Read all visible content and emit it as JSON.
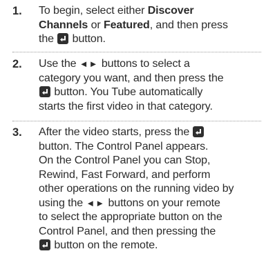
{
  "steps": [
    {
      "number": "1.",
      "s1_a": "To begin, select either ",
      "s1_b": "Discover",
      "s1_c": "Channels",
      "s1_d": " or ",
      "s1_e": "Featured",
      "s1_f": ", and then press",
      "s1_g": "the ",
      "s1_h": " button."
    },
    {
      "number": "2.",
      "s2_a": "Use the ",
      "s2_arrows": "◄►",
      "s2_b": " buttons to select a",
      "s2_c": "category you want, and then press the",
      "s2_d": " button. You Tube automatically",
      "s2_e": "starts the first video in that category."
    },
    {
      "number": "3.",
      "s3_a": "After the video starts, press the ",
      "s3_b": "button. The Control Panel appears.",
      "s3_c": "On the Control Panel you can Stop,",
      "s3_d": "Rewind, Fast Forward, and perform",
      "s3_e": "other operations on the running video by",
      "s3_f": "using the ",
      "s3_arrows": "◄►",
      "s3_g": " buttons on your remote",
      "s3_h": "to select the appropriate button on the",
      "s3_i": "Control Panel, and then pressing the",
      "s3_j": " button on the remote."
    }
  ],
  "icons": {
    "enter": "enter-button-icon"
  }
}
